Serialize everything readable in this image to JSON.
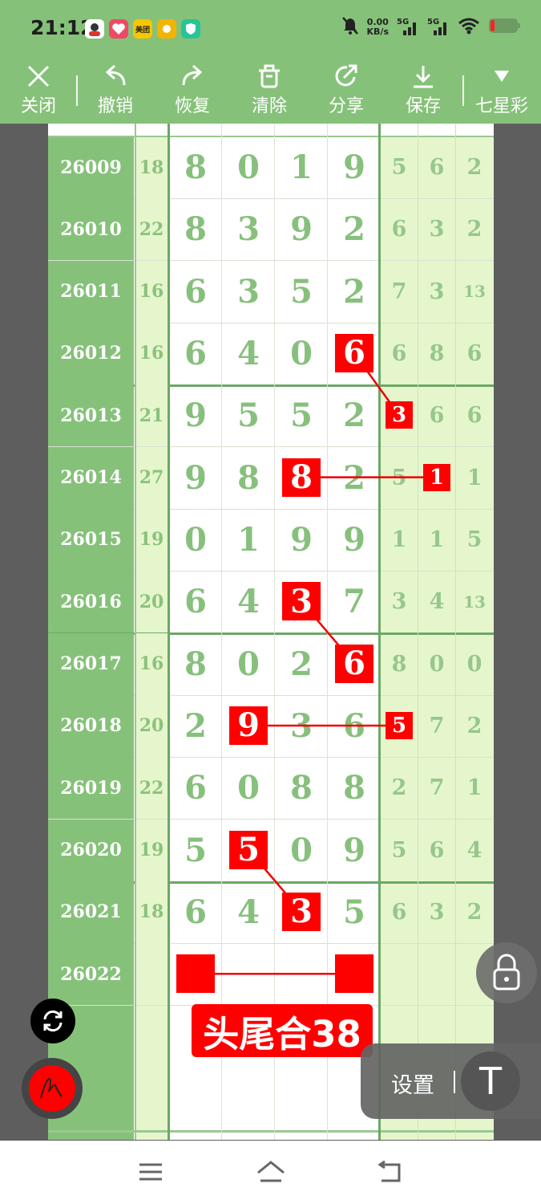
{
  "status_bar": {
    "time": "21:12",
    "net_speed_value": "0.00",
    "net_speed_unit": "KB/s",
    "signal_1": "5G",
    "signal_2": "5G",
    "app_icons": [
      {
        "name": "avatar-app-icon",
        "color": "#ffffff",
        "text": ""
      },
      {
        "name": "heart-app-icon",
        "color": "#ee4a63",
        "text": ""
      },
      {
        "name": "meituan-app-icon",
        "color": "#f7c600",
        "text": "美团"
      },
      {
        "name": "sun-app-icon",
        "color": "#f3b400",
        "text": ""
      },
      {
        "name": "shield-app-icon",
        "color": "#27c497",
        "text": ""
      }
    ]
  },
  "toolbar": {
    "close": "关闭",
    "undo": "撤销",
    "redo": "恢复",
    "clear": "清除",
    "share": "分享",
    "save": "保存",
    "lottery": "七星彩"
  },
  "rows": [
    {
      "issue": "26009",
      "sum": "18",
      "digits": [
        "8",
        "0",
        "1",
        "9"
      ],
      "tails": [
        "5",
        "6",
        "2"
      ]
    },
    {
      "issue": "26010",
      "sum": "22",
      "digits": [
        "8",
        "3",
        "9",
        "2"
      ],
      "tails": [
        "6",
        "3",
        "2"
      ]
    },
    {
      "issue": "26011",
      "sum": "16",
      "digits": [
        "6",
        "3",
        "5",
        "2"
      ],
      "tails": [
        "7",
        "3",
        "13"
      ]
    },
    {
      "issue": "26012",
      "sum": "16",
      "digits": [
        "6",
        "4",
        "0",
        "6"
      ],
      "tails": [
        "6",
        "8",
        "6"
      ]
    },
    {
      "issue": "26013",
      "sum": "21",
      "digits": [
        "9",
        "5",
        "5",
        "2"
      ],
      "tails": [
        "3",
        "6",
        "6"
      ]
    },
    {
      "issue": "26014",
      "sum": "27",
      "digits": [
        "9",
        "8",
        "8",
        "2"
      ],
      "tails": [
        "5",
        "1",
        "1"
      ]
    },
    {
      "issue": "26015",
      "sum": "19",
      "digits": [
        "0",
        "1",
        "9",
        "9"
      ],
      "tails": [
        "1",
        "1",
        "5"
      ]
    },
    {
      "issue": "26016",
      "sum": "20",
      "digits": [
        "6",
        "4",
        "3",
        "7"
      ],
      "tails": [
        "3",
        "4",
        "13"
      ]
    },
    {
      "issue": "26017",
      "sum": "16",
      "digits": [
        "8",
        "0",
        "2",
        "6"
      ],
      "tails": [
        "8",
        "0",
        "0"
      ]
    },
    {
      "issue": "26018",
      "sum": "20",
      "digits": [
        "2",
        "9",
        "3",
        "6"
      ],
      "tails": [
        "5",
        "7",
        "2"
      ]
    },
    {
      "issue": "26019",
      "sum": "22",
      "digits": [
        "6",
        "0",
        "8",
        "8"
      ],
      "tails": [
        "2",
        "7",
        "1"
      ]
    },
    {
      "issue": "26020",
      "sum": "19",
      "digits": [
        "5",
        "5",
        "0",
        "9"
      ],
      "tails": [
        "5",
        "6",
        "4"
      ]
    },
    {
      "issue": "26021",
      "sum": "18",
      "digits": [
        "6",
        "4",
        "3",
        "5"
      ],
      "tails": [
        "6",
        "3",
        "2"
      ]
    },
    {
      "issue": "26022",
      "sum": "",
      "digits": [
        "",
        "",
        "",
        ""
      ],
      "tails": [
        "",
        "",
        ""
      ]
    }
  ],
  "highlights": [
    {
      "row": 3,
      "col": "d3",
      "text": "6"
    },
    {
      "row": 4,
      "col": "t0",
      "text": "3"
    },
    {
      "row": 5,
      "col": "d2",
      "text": "8"
    },
    {
      "row": 5,
      "col": "t1",
      "text": "1"
    },
    {
      "row": 7,
      "col": "d2",
      "text": "3"
    },
    {
      "row": 8,
      "col": "d3",
      "text": "6"
    },
    {
      "row": 9,
      "col": "d1",
      "text": "9"
    },
    {
      "row": 9,
      "col": "t0",
      "text": "5"
    },
    {
      "row": 11,
      "col": "d1",
      "text": "5"
    },
    {
      "row": 12,
      "col": "d2",
      "text": "3"
    }
  ],
  "annotation_label": "头尾合38",
  "settings_label": "设置",
  "text_tool_label": "T",
  "colors": {
    "accent_green": "#86c17a",
    "highlight_red": "#ff0000",
    "light_green": "#e6f6cc"
  }
}
